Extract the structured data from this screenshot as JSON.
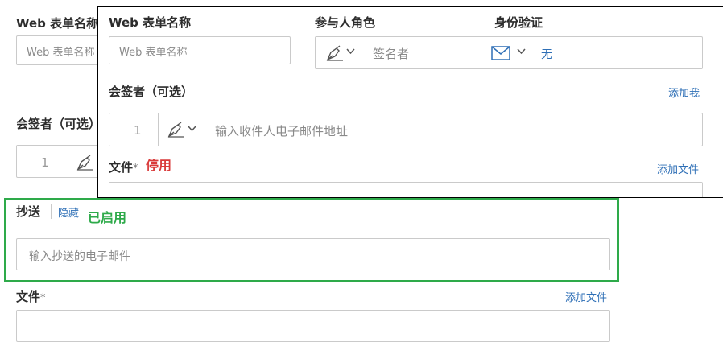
{
  "back": {
    "web_form_name_label": "Web 表单名称",
    "web_form_name_placeholder": "Web 表单名称",
    "cosigner_label": "会签者（可选）",
    "cosigner_index": "1",
    "cc_label": "抄送",
    "hide_link": "隐藏",
    "cc_placeholder": "输入抄送的电子邮件",
    "file_label": "文件",
    "required_mark": "*",
    "add_file_link": "添加文件",
    "enabled_annotation": "已启用"
  },
  "front": {
    "web_form_name_label": "Web 表单名称",
    "web_form_name_placeholder": "Web 表单名称",
    "participant_role_label": "参与人角色",
    "role_value": "签名者",
    "identity_verify_label": "身份验证",
    "identity_value": "无",
    "cosigner_label": "会签者（可选）",
    "add_me_link": "添加我",
    "cosigner_index": "1",
    "recipient_placeholder": "输入收件人电子邮件地址",
    "file_label": "文件",
    "required_mark": "*",
    "disabled_annotation": "停用",
    "add_file_link": "添加文件"
  },
  "colors": {
    "enabled_green": "#2eaa4a",
    "disabled_red": "#d93a3a",
    "link_blue": "#2e6fb6"
  },
  "icons": {
    "pen": "pen-icon",
    "chevron": "chevron-down-icon",
    "envelope": "envelope-icon"
  }
}
